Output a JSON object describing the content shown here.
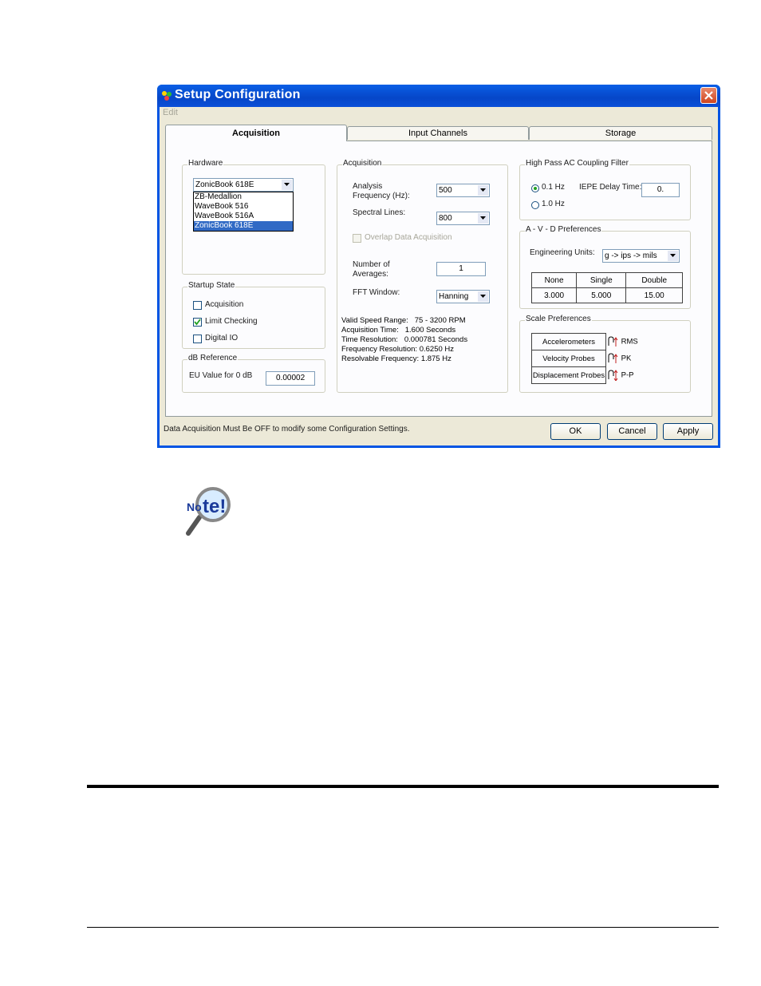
{
  "window": {
    "title": "Setup Configuration",
    "menu_edit": "Edit"
  },
  "tabs": [
    "Acquisition",
    "Input Channels",
    "Storage"
  ],
  "hardware": {
    "label": "Hardware",
    "selected": "ZonicBook 618E",
    "options": [
      "ZB-Medallion",
      "WaveBook 516",
      "WaveBook 516A",
      "ZonicBook 618E"
    ]
  },
  "startup": {
    "label": "Startup State",
    "items": [
      {
        "label": "Acquisition",
        "checked": false
      },
      {
        "label": "Limit Checking",
        "checked": true
      },
      {
        "label": "Digital IO",
        "checked": false
      }
    ]
  },
  "db_ref": {
    "label": "dB Reference",
    "eu_label": "EU Value for 0 dB",
    "eu_value": "0.00002"
  },
  "acquisition": {
    "label": "Acquisition",
    "analysis_freq_label_1": "Analysis",
    "analysis_freq_label_2": "Frequency (Hz):",
    "analysis_freq_value": "500",
    "spectral_lines_label": "Spectral Lines:",
    "spectral_lines_value": "800",
    "overlap_label": "Overlap Data Acquisition",
    "num_avg_label_1": "Number of",
    "num_avg_label_2": "Averages:",
    "num_avg_value": "1",
    "fft_label": "FFT Window:",
    "fft_value": "Hanning",
    "info": [
      {
        "k": "Valid Speed Range:",
        "v": "75  - 3200  RPM"
      },
      {
        "k": "Acquisition Time:",
        "v": "1.600 Seconds"
      },
      {
        "k": "Time Resolution:",
        "v": "0.000781 Seconds"
      },
      {
        "k": "Frequency Resolution:",
        "v": "0.6250 Hz"
      },
      {
        "k": "Resolvable Frequency:",
        "v": "1.875 Hz"
      }
    ]
  },
  "hpf": {
    "label": "High Pass AC Coupling Filter",
    "opt1": "0.1 Hz",
    "opt2": "1.0 Hz",
    "iepe_label": "IEPE Delay Time:",
    "iepe_value": "0."
  },
  "avd": {
    "label": "A - V - D  Preferences",
    "eng_units_label": "Engineering  Units:",
    "eng_units_value": "g -> ips -> mils",
    "headers": [
      "None",
      "Single",
      "Double"
    ],
    "values": [
      "3.000",
      "5.000",
      "15.00"
    ]
  },
  "scale": {
    "label": "Scale Preferences",
    "rows": [
      {
        "name": "Accelerometers",
        "unit": "RMS"
      },
      {
        "name": "Velocity Probes",
        "unit": "PK"
      },
      {
        "name": "Displacement Probes",
        "unit": "P-P"
      }
    ]
  },
  "status": "Data Acquisition Must Be OFF to modify some Configuration Settings.",
  "buttons": {
    "ok": "OK",
    "cancel": "Cancel",
    "apply": "Apply"
  },
  "note_logo": "Note!"
}
